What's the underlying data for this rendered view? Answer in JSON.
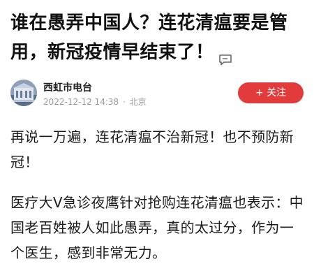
{
  "article": {
    "title": "谁在愚弄中国人？连花清瘟要是管用，新冠疫情早结束了！",
    "comment_icon": "comment-icon"
  },
  "author": {
    "name": "西虹市电台",
    "date": "2022-12-12 14:38",
    "separator": "·",
    "location": "北京",
    "follow_label": "+ 关注",
    "avatar_icon": "building-avatar-icon"
  },
  "body": {
    "paragraphs": [
      "再说一万遍，连花清瘟不治新冠！也不预防新冠！",
      "医疗大V急诊夜鹰针对抢购连花清瘟也表示：中国老百姓被人如此愚弄，真的太过分，作为一个医生，感到非常无力。"
    ]
  },
  "colors": {
    "accent": "#e23b3b",
    "meta": "#999999",
    "text": "#1a1a1a"
  }
}
